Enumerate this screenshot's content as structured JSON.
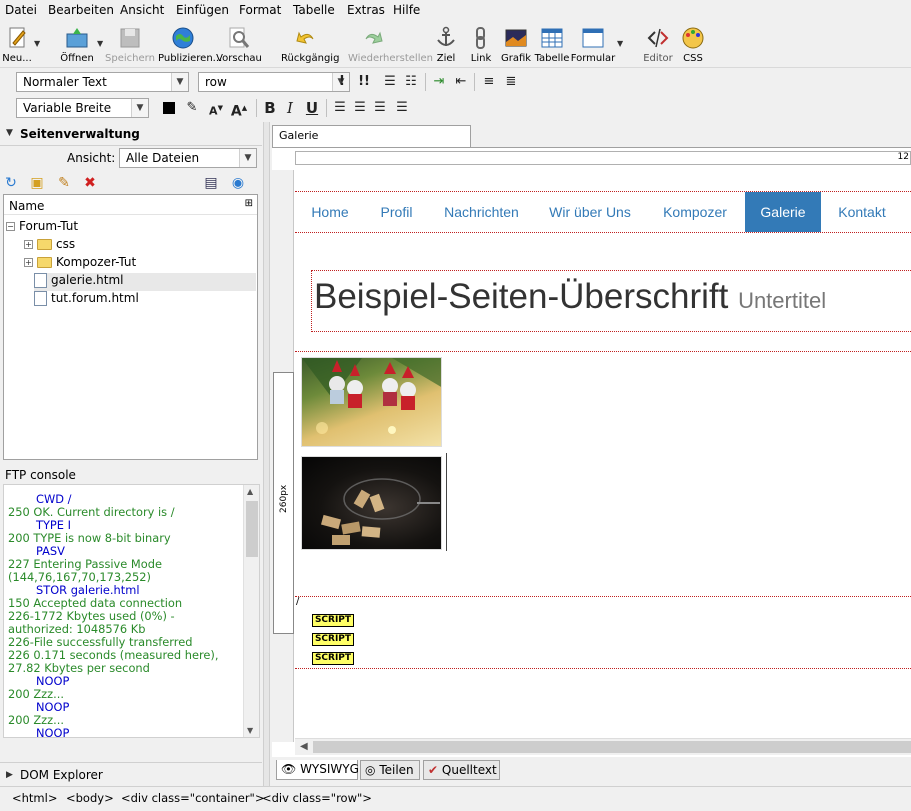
{
  "menu": [
    "Datei",
    "Bearbeiten",
    "Ansicht",
    "Einfügen",
    "Format",
    "Tabelle",
    "Extras",
    "Hilfe"
  ],
  "toolbar": {
    "new": "Neu...",
    "open": "Öffnen",
    "save": "Speichern",
    "publish": "Publizieren...",
    "preview": "Vorschau",
    "undo": "Rückgängig",
    "redo": "Wiederherstellen",
    "anchor": "Ziel",
    "link": "Link",
    "image": "Grafik",
    "table": "Tabelle",
    "form": "Formular",
    "editor": "Editor",
    "css": "CSS"
  },
  "format_bar": {
    "paragraph_format": "Normaler Text",
    "class": "row",
    "width": "Variable Breite"
  },
  "site_manager": {
    "title": "Seitenverwaltung",
    "view_label": "Ansicht:",
    "view_value": "Alle Dateien",
    "column_name": "Name",
    "root": "Forum-Tut",
    "items": [
      "css",
      "Kompozer-Tut",
      "galerie.html",
      "tut.forum.html"
    ]
  },
  "ftp": {
    "label": "FTP console",
    "lines": [
      {
        "type": "cmd",
        "text": "CWD /"
      },
      {
        "type": "resp",
        "text": "250 OK. Current directory is /"
      },
      {
        "type": "cmd",
        "text": "TYPE I"
      },
      {
        "type": "resp",
        "text": "200 TYPE is now 8-bit binary"
      },
      {
        "type": "cmd",
        "text": "PASV"
      },
      {
        "type": "resp",
        "text": "227 Entering Passive Mode"
      },
      {
        "type": "resp",
        "text": "(144,76,167,70,173,252)"
      },
      {
        "type": "cmd",
        "text": "STOR galerie.html"
      },
      {
        "type": "resp",
        "text": "150 Accepted data connection"
      },
      {
        "type": "resp",
        "text": "226-1772 Kbytes used (0%) -"
      },
      {
        "type": "resp",
        "text": "authorized: 1048576 Kb"
      },
      {
        "type": "resp",
        "text": "226-File successfully transferred"
      },
      {
        "type": "resp",
        "text": "226 0.171 seconds (measured here),"
      },
      {
        "type": "resp",
        "text": "27.82 Kbytes per second"
      },
      {
        "type": "cmd",
        "text": "NOOP"
      },
      {
        "type": "resp",
        "text": "200 Zzz..."
      },
      {
        "type": "cmd",
        "text": "NOOP"
      },
      {
        "type": "resp",
        "text": "200 Zzz..."
      },
      {
        "type": "cmd",
        "text": "NOOP"
      }
    ]
  },
  "dom_explorer": "DOM Explorer",
  "document_tab": "Galerie",
  "ruler_label": "12",
  "side_ruler_label": "260px",
  "page": {
    "nav": [
      "Home",
      "Profil",
      "Nachrichten",
      "Wir über Uns",
      "Kompozer",
      "Galerie",
      "Kontakt"
    ],
    "active_nav": "Galerie",
    "heading": "Beispiel-Seiten-Überschrift",
    "subtitle": "Untertitel",
    "slash": "/",
    "script_tags": [
      "SCRIPT",
      "SCRIPT",
      "SCRIPT"
    ]
  },
  "view_tabs": [
    "WYSIWYG",
    "Teilen",
    "Quelltext"
  ],
  "status_path": [
    "<html>",
    "<body>",
    "<div class=\"container\">",
    "<div class=\"row\">"
  ],
  "colors": {
    "nav_link": "#337ab7",
    "nav_active_bg": "#337ab7",
    "ftp_command": "#0000cc",
    "ftp_response": "#2a8a2a"
  }
}
